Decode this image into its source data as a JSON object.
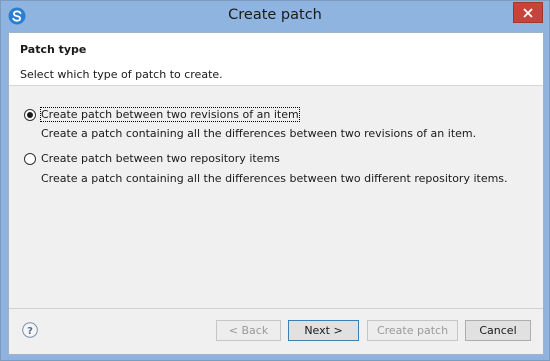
{
  "window": {
    "title": "Create patch",
    "app_icon": "s-logo-icon",
    "close_icon": "close-icon"
  },
  "header": {
    "title": "Patch type",
    "description": "Select which type of patch to create."
  },
  "options": [
    {
      "label": "Create patch between two revisions of an item",
      "description": "Create a patch containing all the differences between two revisions of an item.",
      "selected": true
    },
    {
      "label": "Create patch between two repository items",
      "description": "Create a patch containing all the differences between two different repository items.",
      "selected": false
    }
  ],
  "footer": {
    "help_icon": "help-icon",
    "back_label": "< Back",
    "next_label": "Next >",
    "finish_label": "Create patch",
    "cancel_label": "Cancel"
  },
  "colors": {
    "titlebar": "#8fb4df",
    "close_button": "#c7443a",
    "app_icon": "#2a7fd4"
  }
}
